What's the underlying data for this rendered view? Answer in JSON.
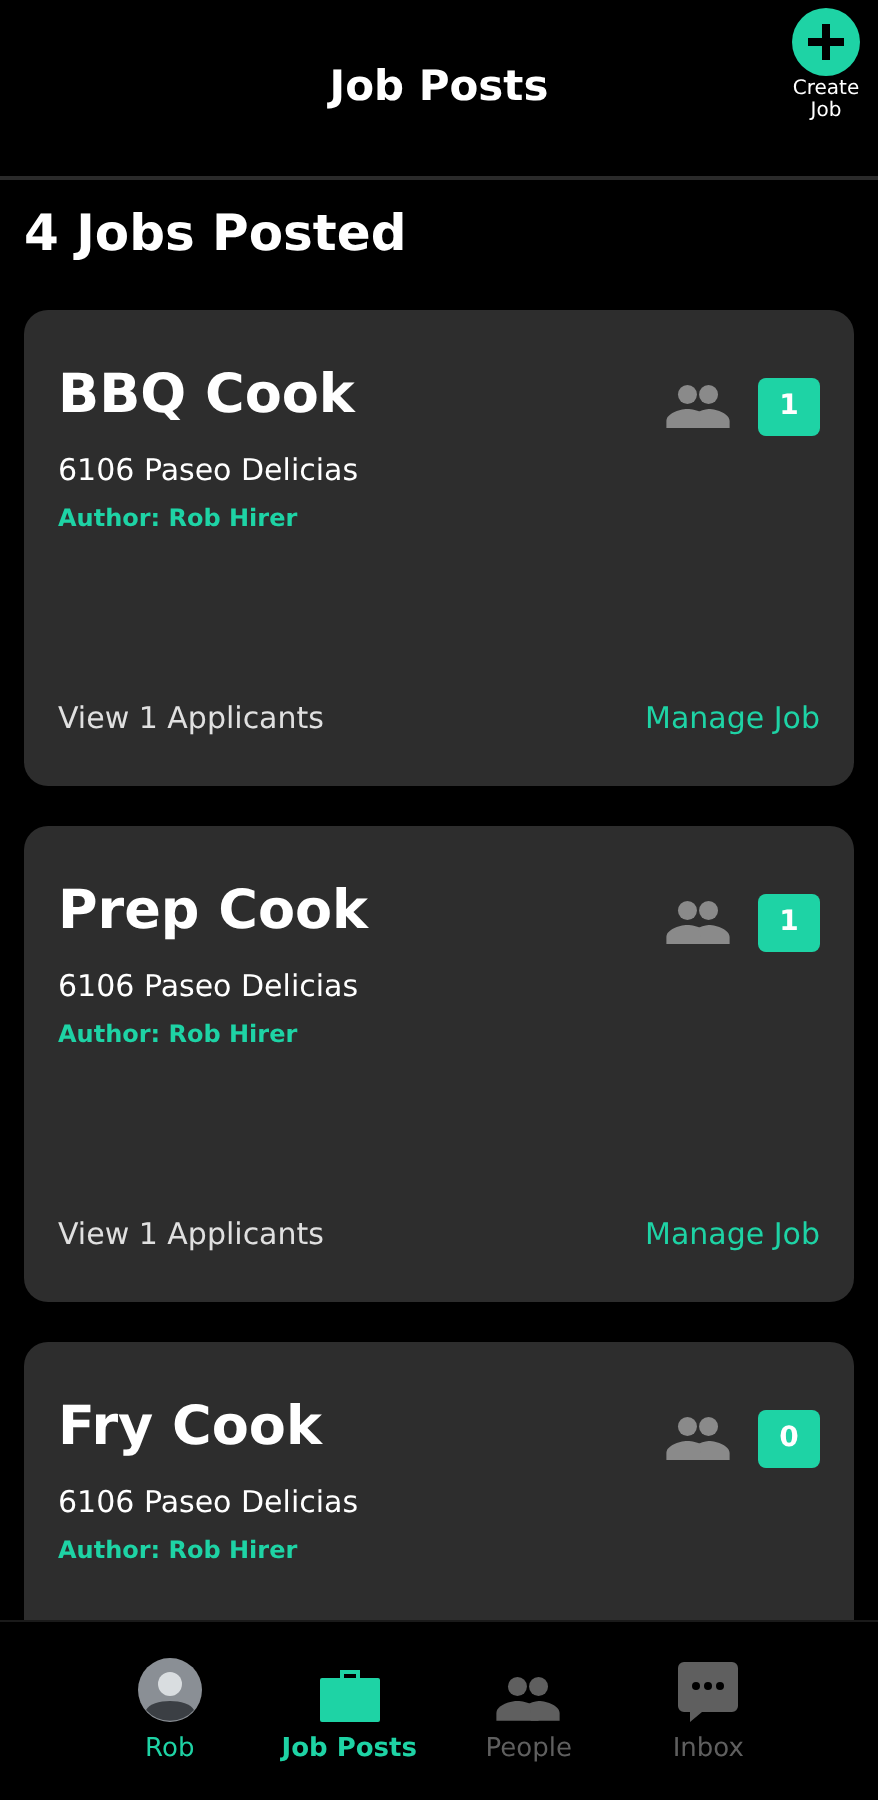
{
  "header": {
    "title": "Job Posts",
    "create_button": "Create\nJob"
  },
  "summary": "4 Jobs Posted",
  "jobs": [
    {
      "title": "BBQ Cook",
      "address": "6106 Paseo Delicias",
      "author": "Author: Rob Hirer",
      "count": "1",
      "applicants": "View 1 Applicants",
      "manage": "Manage Job"
    },
    {
      "title": "Prep Cook",
      "address": "6106 Paseo Delicias",
      "author": "Author: Rob Hirer",
      "count": "1",
      "applicants": "View 1 Applicants",
      "manage": "Manage Job"
    },
    {
      "title": "Fry Cook",
      "address": "6106 Paseo Delicias",
      "author": "Author: Rob Hirer",
      "count": "0"
    }
  ],
  "nav": [
    {
      "kind": "avatar",
      "label": "Rob",
      "selected": false,
      "color": "#1ed3a5"
    },
    {
      "kind": "briefcase",
      "label": "Job Posts",
      "selected": true,
      "color": "#1ed3a5"
    },
    {
      "kind": "people",
      "label": "People",
      "selected": false,
      "color": "#5f5f5f"
    },
    {
      "kind": "chat",
      "label": "Inbox",
      "selected": false,
      "color": "#5f5f5f"
    }
  ]
}
